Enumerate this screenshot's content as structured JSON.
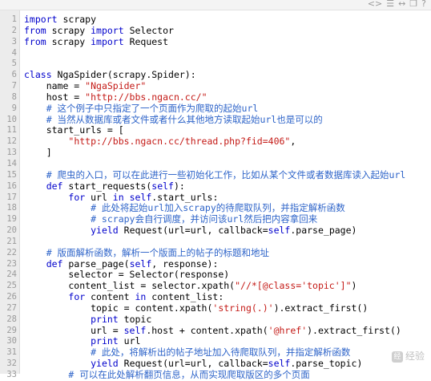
{
  "toolbar": {
    "icons": [
      "code-view-icon",
      "plain-text-icon",
      "expand-icon",
      "copy-icon",
      "help-icon"
    ]
  },
  "lines": [
    {
      "n": "1",
      "t": [
        [
          "k",
          "import"
        ],
        [
          "p",
          " scrapy"
        ]
      ]
    },
    {
      "n": "2",
      "t": [
        [
          "k",
          "from"
        ],
        [
          "p",
          " scrapy "
        ],
        [
          "k",
          "import"
        ],
        [
          "p",
          " Selector"
        ]
      ]
    },
    {
      "n": "3",
      "t": [
        [
          "k",
          "from"
        ],
        [
          "p",
          " scrapy "
        ],
        [
          "k",
          "import"
        ],
        [
          "p",
          " Request"
        ]
      ]
    },
    {
      "n": "4",
      "t": []
    },
    {
      "n": "5",
      "t": []
    },
    {
      "n": "6",
      "t": [
        [
          "k",
          "class"
        ],
        [
          "p",
          " NgaSpider(scrapy.Spider):"
        ]
      ]
    },
    {
      "n": "7",
      "t": [
        [
          "p",
          "    name = "
        ],
        [
          "s",
          "\"NgaSpider\""
        ]
      ]
    },
    {
      "n": "8",
      "t": [
        [
          "p",
          "    host = "
        ],
        [
          "s",
          "\"http://bbs.ngacn.cc/\""
        ]
      ]
    },
    {
      "n": "9",
      "t": [
        [
          "c",
          "    # 这个例子中只指定了一个页面作为爬取的起始url"
        ]
      ]
    },
    {
      "n": "10",
      "t": [
        [
          "c",
          "    # 当然从数据库或者文件或者什么其他地方读取起始url也是可以的"
        ]
      ]
    },
    {
      "n": "11",
      "t": [
        [
          "p",
          "    start_urls = ["
        ]
      ]
    },
    {
      "n": "12",
      "t": [
        [
          "p",
          "        "
        ],
        [
          "s",
          "\"http://bbs.ngacn.cc/thread.php?fid=406\""
        ],
        [
          "p",
          ","
        ]
      ]
    },
    {
      "n": "13",
      "t": [
        [
          "p",
          "    ]"
        ]
      ]
    },
    {
      "n": "14",
      "t": []
    },
    {
      "n": "15",
      "t": [
        [
          "c",
          "    # 爬虫的入口，可以在此进行一些初始化工作，比如从某个文件或者数据库读入起始url"
        ]
      ]
    },
    {
      "n": "16",
      "t": [
        [
          "p",
          "    "
        ],
        [
          "k",
          "def"
        ],
        [
          "p",
          " start_requests("
        ],
        [
          "b",
          "self"
        ],
        [
          "p",
          "):"
        ]
      ]
    },
    {
      "n": "17",
      "t": [
        [
          "p",
          "        "
        ],
        [
          "k",
          "for"
        ],
        [
          "p",
          " url "
        ],
        [
          "k",
          "in"
        ],
        [
          "p",
          " "
        ],
        [
          "b",
          "self"
        ],
        [
          "p",
          ".start_urls:"
        ]
      ]
    },
    {
      "n": "18",
      "t": [
        [
          "c",
          "            # 此处将起始url加入scrapy的待爬取队列，并指定解析函数"
        ]
      ]
    },
    {
      "n": "19",
      "t": [
        [
          "c",
          "            # scrapy会自行调度，并访问该url然后把内容拿回来"
        ]
      ]
    },
    {
      "n": "20",
      "t": [
        [
          "p",
          "            "
        ],
        [
          "k",
          "yield"
        ],
        [
          "p",
          " Request(url=url, callback="
        ],
        [
          "b",
          "self"
        ],
        [
          "p",
          ".parse_page)"
        ]
      ]
    },
    {
      "n": "21",
      "t": []
    },
    {
      "n": "22",
      "t": [
        [
          "c",
          "    # 版面解析函数，解析一个版面上的帖子的标题和地址"
        ]
      ]
    },
    {
      "n": "23",
      "t": [
        [
          "p",
          "    "
        ],
        [
          "k",
          "def"
        ],
        [
          "p",
          " parse_page("
        ],
        [
          "b",
          "self"
        ],
        [
          "p",
          ", response):"
        ]
      ]
    },
    {
      "n": "24",
      "t": [
        [
          "p",
          "        selector = Selector(response)"
        ]
      ]
    },
    {
      "n": "25",
      "t": [
        [
          "p",
          "        content_list = selector.xpath("
        ],
        [
          "s",
          "\"//*[@class='topic']\""
        ],
        [
          "p",
          ")"
        ]
      ]
    },
    {
      "n": "26",
      "t": [
        [
          "p",
          "        "
        ],
        [
          "k",
          "for"
        ],
        [
          "p",
          " content "
        ],
        [
          "k",
          "in"
        ],
        [
          "p",
          " content_list:"
        ]
      ]
    },
    {
      "n": "27",
      "t": [
        [
          "p",
          "            topic = content.xpath("
        ],
        [
          "s",
          "'string(.)'"
        ],
        [
          "p",
          ").extract_first()"
        ]
      ]
    },
    {
      "n": "28",
      "t": [
        [
          "p",
          "            "
        ],
        [
          "k",
          "print"
        ],
        [
          "p",
          " topic"
        ]
      ]
    },
    {
      "n": "29",
      "t": [
        [
          "p",
          "            url = "
        ],
        [
          "b",
          "self"
        ],
        [
          "p",
          ".host + content.xpath("
        ],
        [
          "s",
          "'@href'"
        ],
        [
          "p",
          ").extract_first()"
        ]
      ]
    },
    {
      "n": "30",
      "t": [
        [
          "p",
          "            "
        ],
        [
          "k",
          "print"
        ],
        [
          "p",
          " url"
        ]
      ]
    },
    {
      "n": "31",
      "t": [
        [
          "c",
          "            # 此处，将解析出的帖子地址加入待爬取队列，并指定解析函数"
        ]
      ]
    },
    {
      "n": "32",
      "t": [
        [
          "p",
          "            "
        ],
        [
          "k",
          "yield"
        ],
        [
          "p",
          " Request(url=url, callback="
        ],
        [
          "b",
          "self"
        ],
        [
          "p",
          ".parse_topic)"
        ]
      ]
    },
    {
      "n": "33",
      "t": [
        [
          "c",
          "        # 可以在此处解析翻页信息，从而实现爬取版区的多个页面"
        ]
      ]
    }
  ],
  "watermark": {
    "badge": "经",
    "text": "经验"
  },
  "colors": {
    "keyword": "#0000cc",
    "string": "#c41a16",
    "comment": "#2e64c9",
    "text": "#000000"
  }
}
